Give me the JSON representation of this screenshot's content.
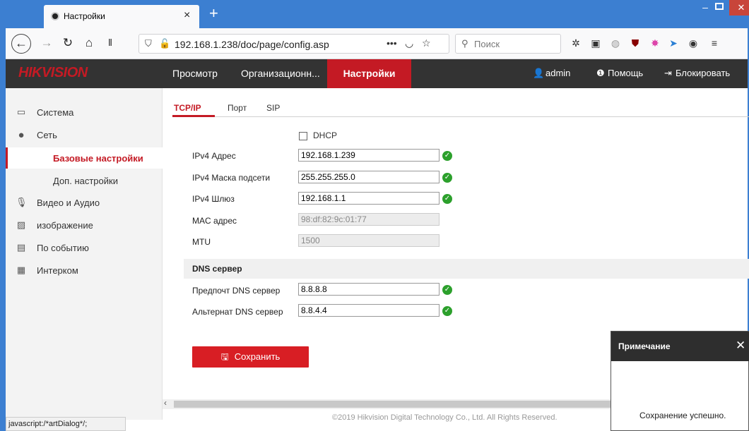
{
  "browser": {
    "tab_title": "Настройки",
    "tab_close": "×",
    "new_tab": "+",
    "url": "192.168.1.238/doc/page/config.asp",
    "search_placeholder": "Поиск",
    "url_more": "•••",
    "win_min": "–",
    "win_close": "✕",
    "status_text": "javascript:/*artDialog*/;"
  },
  "header": {
    "logo": "HIKVISION",
    "menu": [
      "Просмотр",
      "Организационн...",
      "Настройки"
    ],
    "user": "admin",
    "help": "Помощь",
    "lock": "Блокировать"
  },
  "sidebar": {
    "items": [
      {
        "label": "Система",
        "icon": "monitor-icon"
      },
      {
        "label": "Сеть",
        "icon": "globe-icon"
      },
      {
        "label": "Базовые настройки",
        "sub": true,
        "active": true
      },
      {
        "label": "Доп. настройки",
        "sub": true
      },
      {
        "label": "Видео и Аудио",
        "icon": "mic-icon"
      },
      {
        "label": "изображение",
        "icon": "image-icon"
      },
      {
        "label": "По событию",
        "icon": "calendar-icon"
      },
      {
        "label": "Интерком",
        "icon": "intercom-icon"
      }
    ]
  },
  "tabs": [
    "TCP/IP",
    "Порт",
    "SIP"
  ],
  "form": {
    "dhcp_label": "DHCP",
    "ipv4_label": "IPv4 Адрес",
    "ipv4_value": "192.168.1.239",
    "mask_label": "IPv4 Маска подсети",
    "mask_value": "255.255.255.0",
    "gw_label": "IPv4 Шлюз",
    "gw_value": "192.168.1.1",
    "mac_label": "MAC адрес",
    "mac_value": "98:df:82:9c:01:77",
    "mtu_label": "MTU",
    "mtu_value": "1500",
    "dns_section": "DNS сервер",
    "dns1_label": "Предпочт DNS сервер",
    "dns1_value": "8.8.8.8",
    "dns2_label": "Альтернат DNS сервер",
    "dns2_value": "8.8.4.4",
    "save_label": "Сохранить"
  },
  "footer": "©2019 Hikvision Digital Technology Co., Ltd. All Rights Reserved.",
  "dialog": {
    "title": "Примечание",
    "close": "✕",
    "message": "Сохранение успешно."
  },
  "colors": {
    "accent": "#c41a24",
    "titlebar": "#3c7fd1",
    "header": "#333333",
    "ok": "#2ca02c"
  }
}
